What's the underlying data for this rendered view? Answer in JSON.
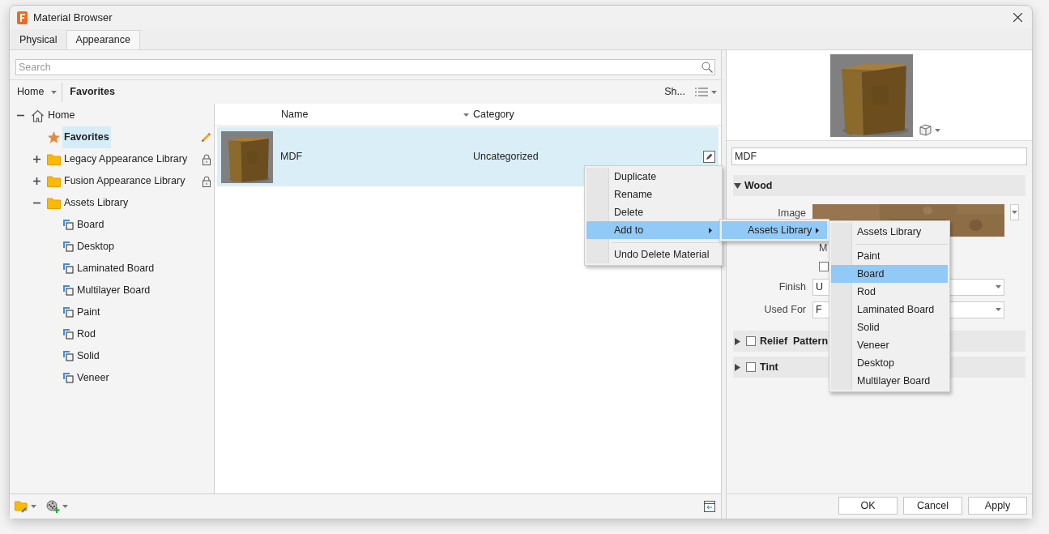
{
  "window": {
    "title": "Material Browser"
  },
  "tabs": [
    {
      "label": "Physical",
      "selected": false
    },
    {
      "label": "Appearance",
      "selected": true
    }
  ],
  "search": {
    "placeholder": "Search"
  },
  "breadcrumb": {
    "home": "Home",
    "current": "Favorites"
  },
  "view_toolbar": {
    "show_label": "Sh..."
  },
  "tree": [
    {
      "label": "Home",
      "kind": "home",
      "expanded": true,
      "selected": false,
      "locked": false,
      "children": [
        {
          "label": "Favorites",
          "kind": "favorites",
          "selected": true,
          "locked": false
        },
        {
          "label": "Legacy Appearance Library",
          "kind": "library",
          "expanded": false,
          "selected": false,
          "locked": true
        },
        {
          "label": "Fusion Appearance Library",
          "kind": "library",
          "expanded": false,
          "selected": false,
          "locked": true
        },
        {
          "label": "Assets Library",
          "kind": "library",
          "expanded": true,
          "selected": false,
          "locked": false,
          "children": [
            {
              "label": "Board",
              "kind": "category",
              "selected": false,
              "locked": false
            },
            {
              "label": "Desktop",
              "kind": "category",
              "selected": false,
              "locked": false
            },
            {
              "label": "Laminated Board",
              "kind": "category",
              "selected": false,
              "locked": false
            },
            {
              "label": "Multilayer Board",
              "kind": "category",
              "selected": false,
              "locked": false
            },
            {
              "label": "Paint",
              "kind": "category",
              "selected": false,
              "locked": false
            },
            {
              "label": "Rod",
              "kind": "category",
              "selected": false,
              "locked": false
            },
            {
              "label": "Solid",
              "kind": "category",
              "selected": false,
              "locked": false
            },
            {
              "label": "Veneer",
              "kind": "category",
              "selected": false,
              "locked": false
            }
          ]
        }
      ]
    }
  ],
  "list": {
    "columns": [
      "Name",
      "Category"
    ],
    "rows": [
      {
        "name": "MDF",
        "category": "Uncategorized",
        "selected": true
      }
    ]
  },
  "context_menu": [
    {
      "kind": "item",
      "label": "Duplicate",
      "highlighted": false
    },
    {
      "kind": "item",
      "label": "Rename",
      "highlighted": false
    },
    {
      "kind": "item",
      "label": "Delete",
      "highlighted": false
    },
    {
      "kind": "submenu",
      "label": "Add to",
      "highlighted": true
    },
    {
      "kind": "separator"
    },
    {
      "kind": "item",
      "label": "Undo Delete Material",
      "highlighted": false
    }
  ],
  "submenu": [
    {
      "kind": "submenu",
      "label": "Assets Library",
      "highlighted": true
    }
  ],
  "submenu_2": [
    {
      "kind": "item",
      "label": "Assets Library",
      "highlighted": false
    },
    {
      "kind": "separator"
    },
    {
      "kind": "item",
      "label": "Paint",
      "highlighted": false
    },
    {
      "kind": "item",
      "label": "Board",
      "highlighted": true
    },
    {
      "kind": "item",
      "label": "Rod",
      "highlighted": false
    },
    {
      "kind": "item",
      "label": "Laminated Board",
      "highlighted": false
    },
    {
      "kind": "item",
      "label": "Solid",
      "highlighted": false
    },
    {
      "kind": "item",
      "label": "Veneer",
      "highlighted": false
    },
    {
      "kind": "item",
      "label": "Desktop",
      "highlighted": false
    },
    {
      "kind": "item",
      "label": "Multilayer Board",
      "highlighted": false
    }
  ],
  "editor": {
    "name": "MDF",
    "sections": [
      {
        "title": "Wood",
        "expanded": true,
        "has_checkbox": false,
        "fields": [
          {
            "label": "Image"
          },
          {
            "kind": "text",
            "text": "M"
          },
          {
            "kind": "checkbox",
            "checked": false
          },
          {
            "kind": "dropdown",
            "label": "Finish",
            "value": "U"
          },
          {
            "kind": "dropdown",
            "label": "Used For",
            "value": "F"
          }
        ]
      },
      {
        "title": "Relief  Pattern",
        "expanded": false,
        "has_checkbox": true,
        "checked": false
      },
      {
        "title": "Tint",
        "expanded": false,
        "has_checkbox": true,
        "checked": false
      }
    ]
  },
  "buttons": [
    "OK",
    "Cancel",
    "Apply"
  ]
}
